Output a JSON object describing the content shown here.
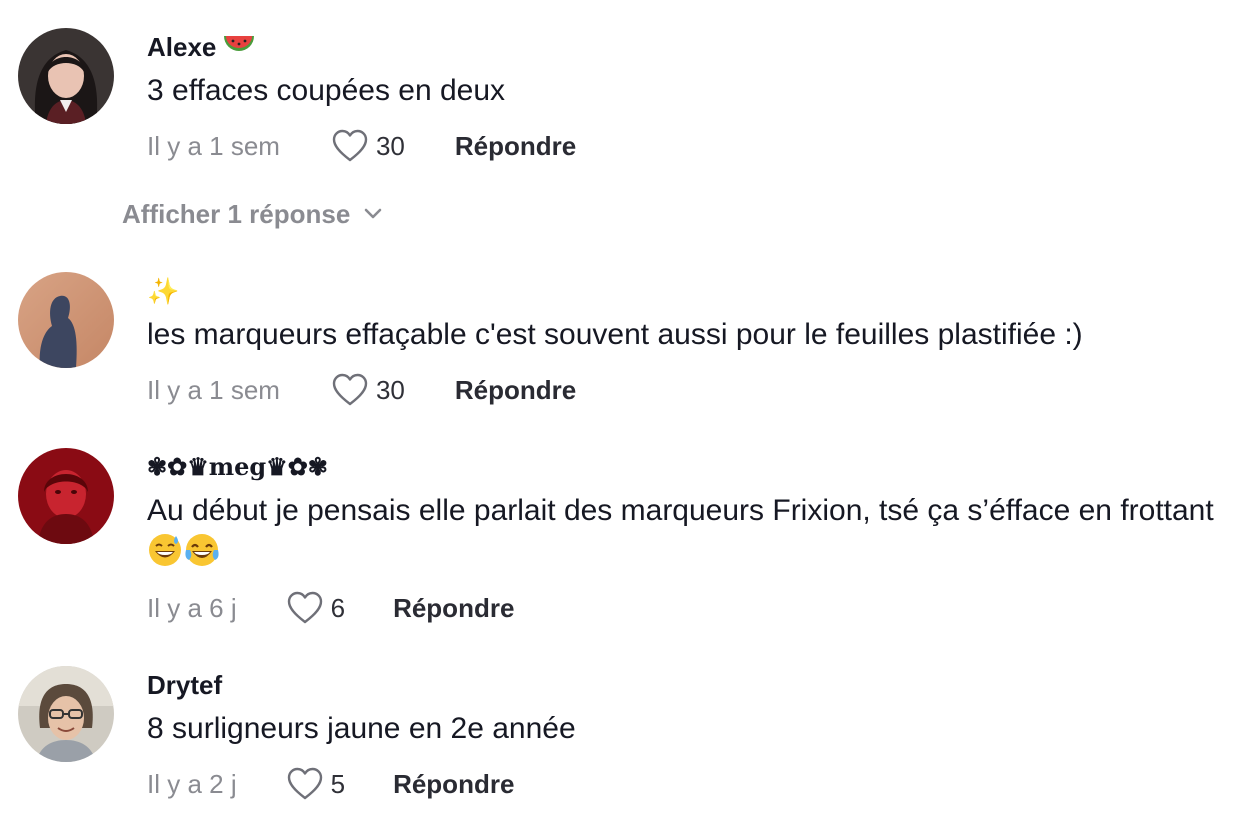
{
  "comments": [
    {
      "username": "Alexe",
      "username_emoji": "watermelon-emoji",
      "text": "3 effaces coupées en deux",
      "time": "Il y a 1 sem",
      "likes": "30",
      "reply_label": "Répondre",
      "view_replies": "Afficher 1 réponse"
    },
    {
      "username": "✨",
      "text": "les marqueurs effaçable c'est souvent aussi pour le feuilles plastifiée :)",
      "time": "Il y a 1 sem",
      "likes": "30",
      "reply_label": "Répondre"
    },
    {
      "username": "✾✿♛𝐦𝐞𝐠♛✿✾",
      "text": "Au début je pensais elle parlait des marqueurs Frixion, tsé ça s’éfface en frottant",
      "text_emojis": [
        "grinning-sweat-emoji",
        "tears-of-joy-emoji"
      ],
      "time": "Il y a 6 j",
      "likes": "6",
      "reply_label": "Répondre"
    },
    {
      "username": "Drytef",
      "text": "8 surligneurs jaune en 2e année",
      "time": "Il y a 2 j",
      "likes": "5",
      "reply_label": "Répondre"
    }
  ],
  "colors": {
    "primary_text": "#161823",
    "secondary_text": "#8a8b91",
    "background": "#ffffff"
  }
}
